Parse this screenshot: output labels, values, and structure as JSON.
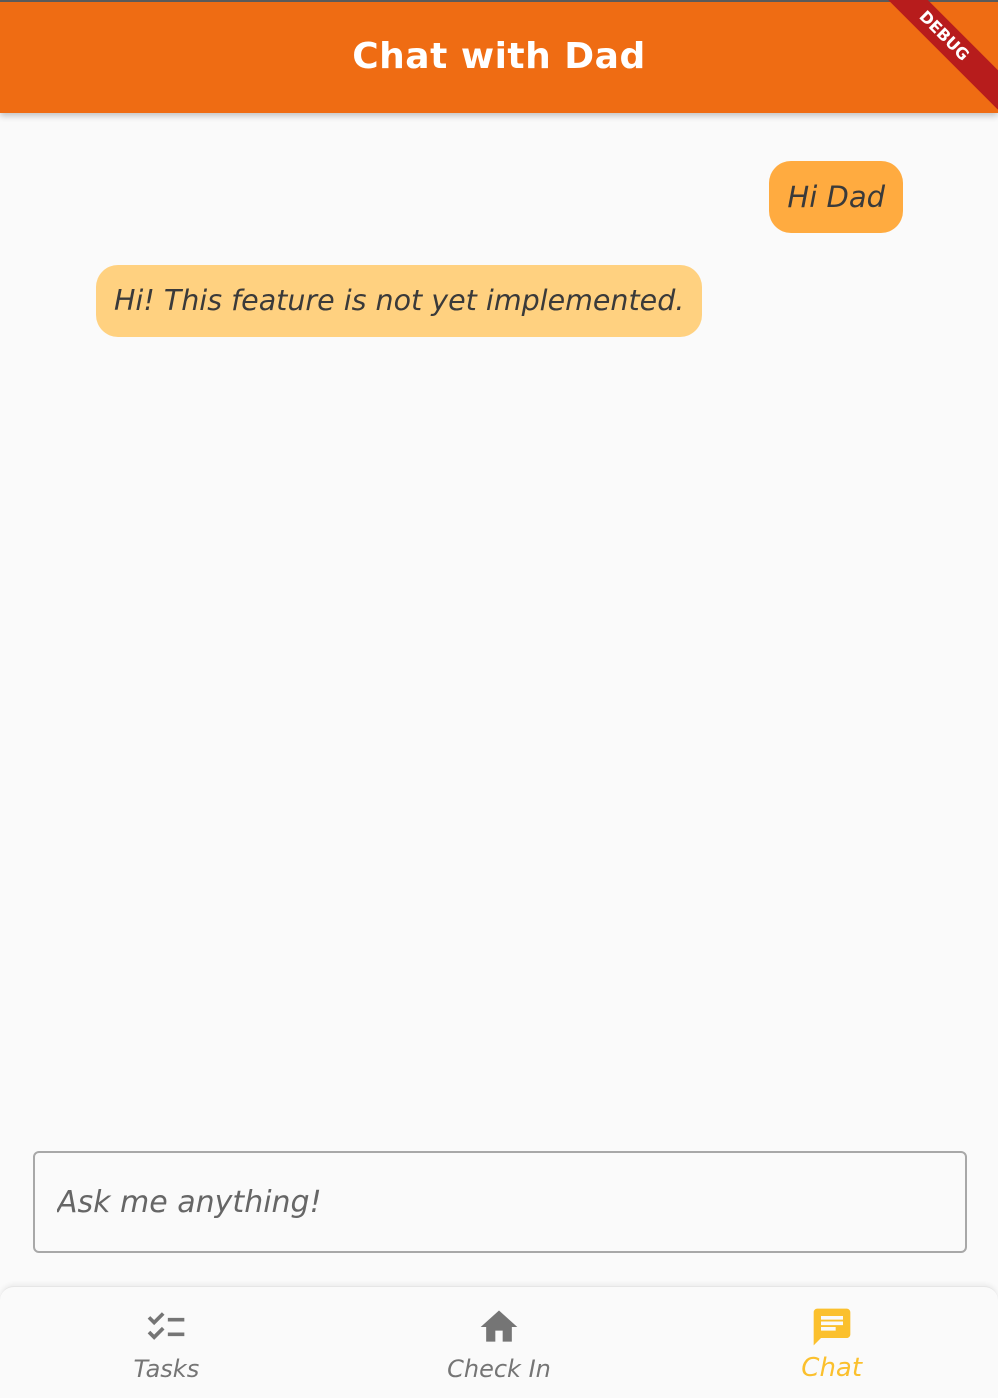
{
  "app_bar": {
    "title": "Chat with Dad",
    "debug_banner": "DEBUG",
    "color": "#ef6c13"
  },
  "messages": [
    {
      "from": "user",
      "text": "Hi Dad",
      "color": "#ffab40"
    },
    {
      "from": "dad",
      "text": "Hi! This feature is not yet implemented.",
      "color": "#ffd180"
    }
  ],
  "input": {
    "placeholder": "Ask me anything!",
    "value": ""
  },
  "bottom_nav": {
    "items": [
      {
        "label": "Tasks",
        "icon": "checklist-icon",
        "active": false
      },
      {
        "label": "Check In",
        "icon": "home-icon",
        "active": false
      },
      {
        "label": "Chat",
        "icon": "chat-icon",
        "active": true
      }
    ],
    "active_color": "#fbc02d",
    "inactive_color": "#757575"
  }
}
